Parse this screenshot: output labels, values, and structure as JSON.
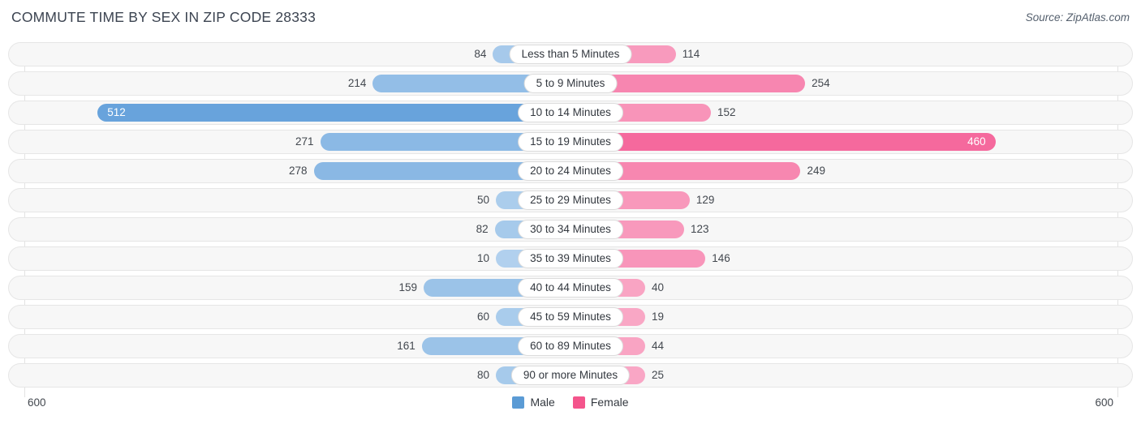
{
  "header": {
    "title": "COMMUTE TIME BY SEX IN ZIP CODE 28333",
    "source": "Source: ZipAtlas.com"
  },
  "axis": {
    "left_max_label": "600",
    "right_max_label": "600"
  },
  "legend": {
    "items": [
      {
        "label": "Male",
        "color": "#5b9bd5"
      },
      {
        "label": "Female",
        "color": "#f4558c"
      }
    ]
  },
  "chart_data": {
    "type": "bar",
    "title": "COMMUTE TIME BY SEX IN ZIP CODE 28333",
    "xlabel": "",
    "ylabel": "",
    "orientation": "horizontal-diverging",
    "grid": true,
    "legend_position": "bottom-center",
    "xlim": [
      600,
      600
    ],
    "categories": [
      "Less than 5 Minutes",
      "5 to 9 Minutes",
      "10 to 14 Minutes",
      "15 to 19 Minutes",
      "20 to 24 Minutes",
      "25 to 29 Minutes",
      "30 to 34 Minutes",
      "35 to 39 Minutes",
      "40 to 44 Minutes",
      "45 to 59 Minutes",
      "60 to 89 Minutes",
      "90 or more Minutes"
    ],
    "series": [
      {
        "name": "Male",
        "side": "left",
        "color": "#5b9bd5",
        "values": [
          84,
          214,
          512,
          271,
          278,
          50,
          82,
          10,
          159,
          60,
          161,
          80
        ]
      },
      {
        "name": "Female",
        "side": "right",
        "color": "#f4558c",
        "values": [
          114,
          254,
          152,
          460,
          249,
          129,
          123,
          146,
          40,
          19,
          44,
          25
        ]
      }
    ]
  },
  "rows": [
    {
      "category": "Less than 5 Minutes",
      "male": "84",
      "female": "114",
      "male_value": 84,
      "female_value": 114,
      "male_inside": false,
      "female_inside": false
    },
    {
      "category": "5 to 9 Minutes",
      "male": "214",
      "female": "254",
      "male_value": 214,
      "female_value": 254,
      "male_inside": false,
      "female_inside": false
    },
    {
      "category": "10 to 14 Minutes",
      "male": "512",
      "female": "152",
      "male_value": 512,
      "female_value": 152,
      "male_inside": true,
      "female_inside": false
    },
    {
      "category": "15 to 19 Minutes",
      "male": "271",
      "female": "460",
      "male_value": 271,
      "female_value": 460,
      "male_inside": false,
      "female_inside": true
    },
    {
      "category": "20 to 24 Minutes",
      "male": "278",
      "female": "249",
      "male_value": 278,
      "female_value": 249,
      "male_inside": false,
      "female_inside": false
    },
    {
      "category": "25 to 29 Minutes",
      "male": "50",
      "female": "129",
      "male_value": 50,
      "female_value": 129,
      "male_inside": false,
      "female_inside": false
    },
    {
      "category": "30 to 34 Minutes",
      "male": "82",
      "female": "123",
      "male_value": 82,
      "female_value": 123,
      "male_inside": false,
      "female_inside": false
    },
    {
      "category": "35 to 39 Minutes",
      "male": "10",
      "female": "146",
      "male_value": 10,
      "female_value": 146,
      "male_inside": false,
      "female_inside": false
    },
    {
      "category": "40 to 44 Minutes",
      "male": "159",
      "female": "40",
      "male_value": 159,
      "female_value": 40,
      "male_inside": false,
      "female_inside": false
    },
    {
      "category": "45 to 59 Minutes",
      "male": "60",
      "female": "19",
      "male_value": 60,
      "female_value": 19,
      "male_inside": false,
      "female_inside": false
    },
    {
      "category": "60 to 89 Minutes",
      "male": "161",
      "female": "44",
      "male_value": 161,
      "female_value": 44,
      "male_inside": false,
      "female_inside": false
    },
    {
      "category": "90 or more Minutes",
      "male": "80",
      "female": "25",
      "male_value": 80,
      "female_value": 25,
      "male_inside": false,
      "female_inside": false
    }
  ]
}
